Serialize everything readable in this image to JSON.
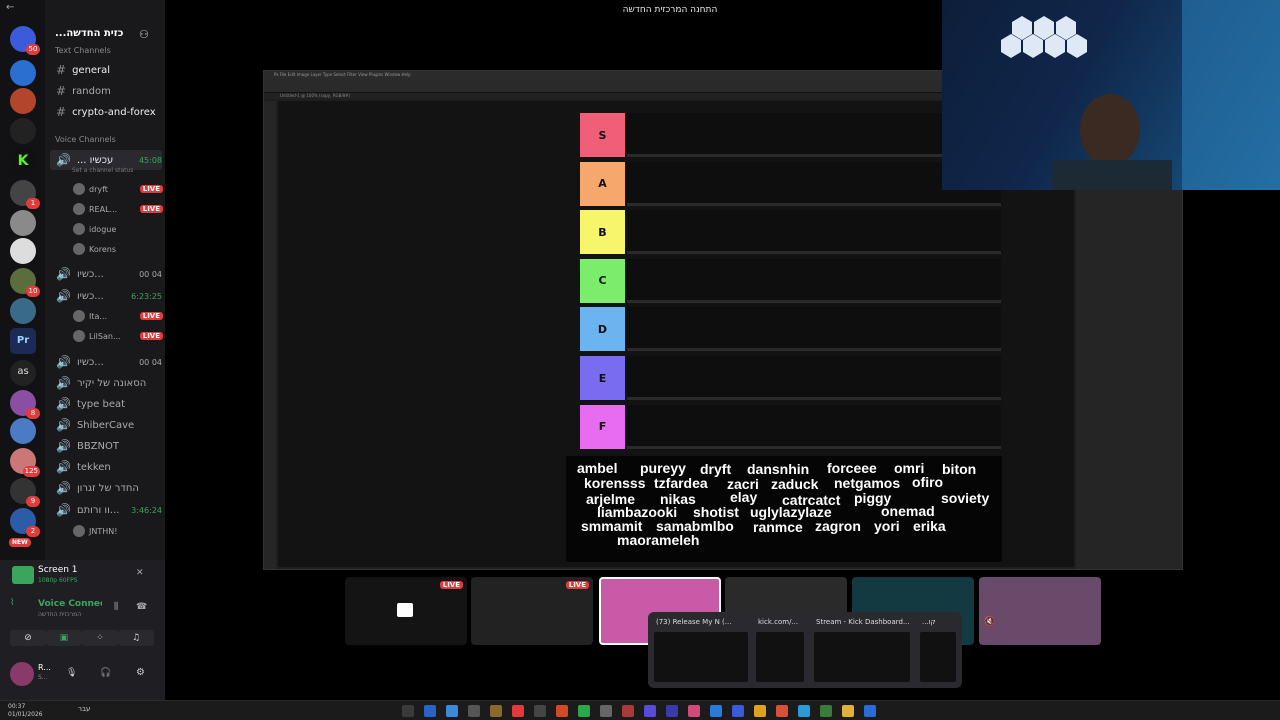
{
  "window_title": "התחנה המרכזית החדשה",
  "server": {
    "name": "...כזית החדשה",
    "text_category": "Text Channels",
    "voice_category": "Voice Channels"
  },
  "text_channels": [
    "general",
    "random",
    "crypto-and-forex"
  ],
  "voice": {
    "active_channel": {
      "name": "... עכשיו",
      "time": "45:08",
      "status": "Set a channel status"
    },
    "users": [
      {
        "name": "dryft",
        "live": "LIVE"
      },
      {
        "name": "REAL...",
        "live": "LIVE"
      },
      {
        "name": "idogue",
        "live": ""
      },
      {
        "name": "Korens",
        "live": ""
      }
    ],
    "channel2": {
      "name": "כשיו...",
      "counts": "00 04"
    },
    "channel3": {
      "name": "כשיו...",
      "time": "6:23:25"
    },
    "users3": [
      {
        "name": "Ita...",
        "live": "LIVE"
      },
      {
        "name": "LilSan...",
        "live": "LIVE"
      }
    ],
    "channel4": {
      "name": "כשיו...",
      "counts": "00 04"
    },
    "others": [
      "הסאונה של יקיר",
      "type beat",
      "ShiberCave",
      "BBZNOT",
      "tekken",
      "החדר של זגרון"
    ],
    "channel5": {
      "name": "וו ורותם...",
      "time": "3:46:24"
    },
    "user5": "JNTHN!"
  },
  "screen_share": {
    "title": "Screen 1",
    "sub": "1080p 60FPS"
  },
  "voice_connected": {
    "label": "Voice Connected",
    "sub": "המרכזית החדשה"
  },
  "user_panel": {
    "name": "R...",
    "status": "S..."
  },
  "rail_badges": [
    "50",
    "1",
    "10",
    "8",
    "125",
    "9",
    "2"
  ],
  "new_badge": "NEW",
  "tiers": [
    {
      "label": "S",
      "color": "#f05f77"
    },
    {
      "label": "A",
      "color": "#f6a86c"
    },
    {
      "label": "B",
      "color": "#f6f56c"
    },
    {
      "label": "C",
      "color": "#7cec6c"
    },
    {
      "label": "D",
      "color": "#6cb4f0"
    },
    {
      "label": "E",
      "color": "#7a6cf0"
    },
    {
      "label": "F",
      "color": "#e86cf0"
    }
  ],
  "names": [
    "ambel",
    "pureyy",
    "dryft",
    "dansnhin",
    "forceee",
    "omri",
    "biton",
    "korensss",
    "tzfardea",
    "zacri",
    "zaduck",
    "netgamos",
    "ofiro",
    "arjelme",
    "nikas",
    "elay",
    "catrcatct",
    "piggy",
    "soviety",
    "liambazooki",
    "shotist",
    "uglylazylaze",
    "onemad",
    "smmamit",
    "samabmlbo",
    "ranmce",
    "zagron",
    "yori",
    "erika",
    "maorameleh"
  ],
  "thumbs_live": [
    "LIVE",
    "LIVE"
  ],
  "tasks": [
    "(73) Release My N (...",
    "kick.com/...",
    "Stream - Kick Dashboard...",
    "...קו"
  ],
  "clock": {
    "time": "00:37",
    "date": "01/01/2026",
    "lang": "עבר"
  }
}
